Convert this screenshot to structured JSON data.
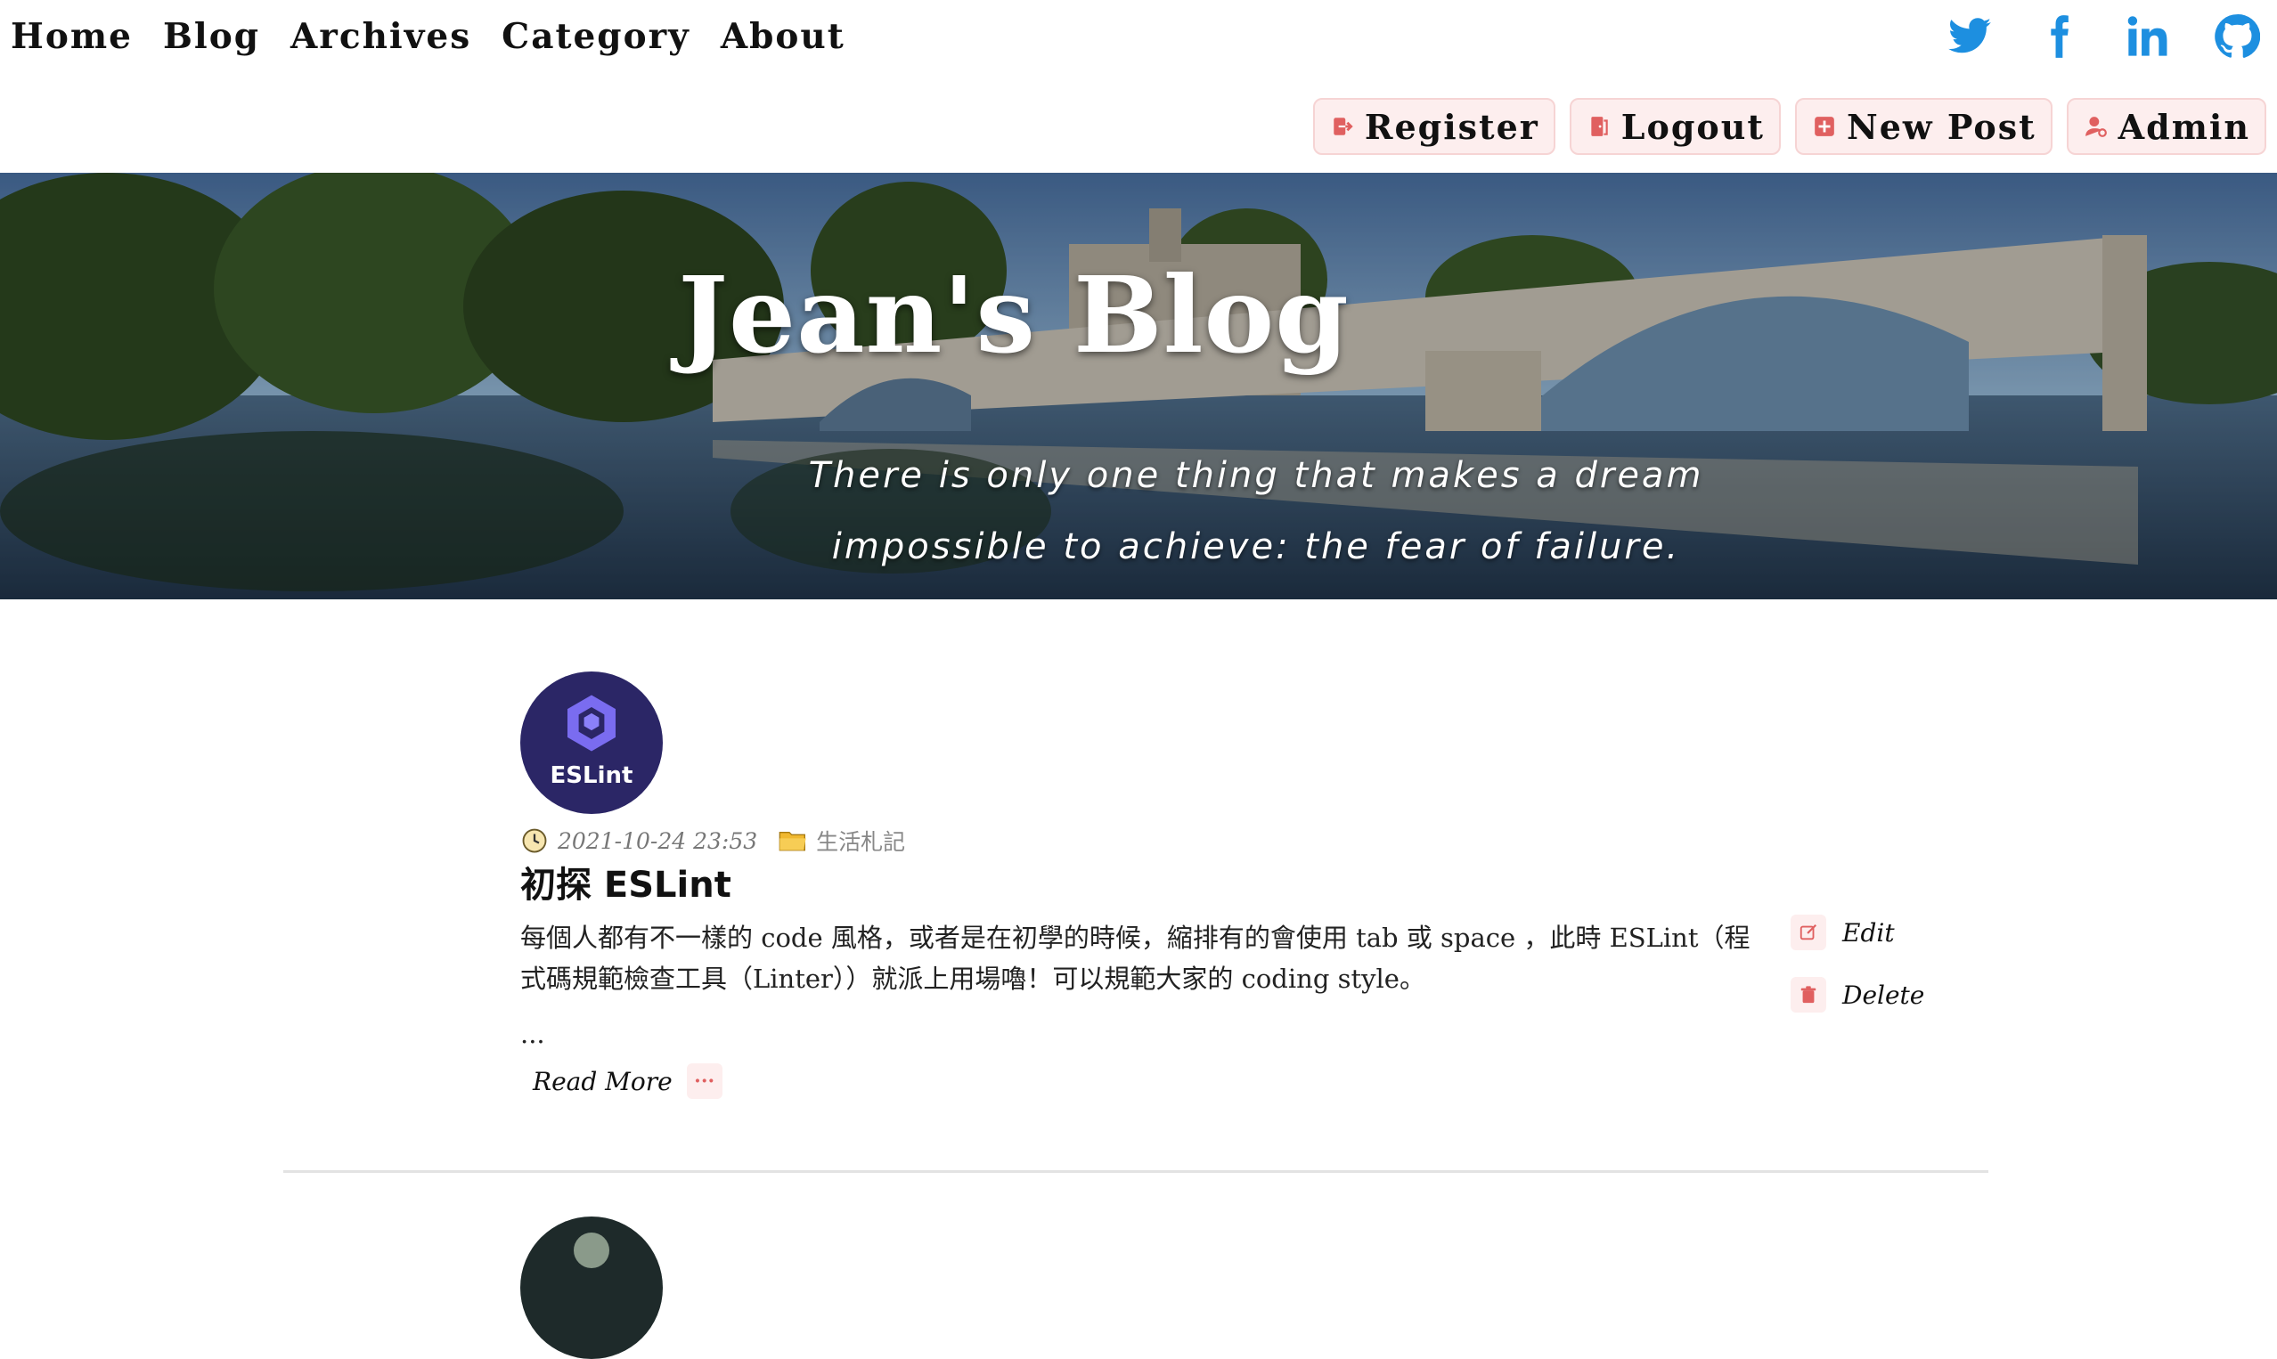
{
  "nav": {
    "items": [
      "Home",
      "Blog",
      "Archives",
      "Category",
      "About"
    ]
  },
  "social": {
    "icons": [
      "twitter-icon",
      "facebook-icon",
      "linkedin-icon",
      "github-icon"
    ],
    "brand_color": "#1d8fe0"
  },
  "actions": {
    "register": "Register",
    "logout": "Logout",
    "new_post": "New Post",
    "admin": "Admin",
    "icon_color": "#e06060",
    "bg_color": "#fdeeee"
  },
  "hero": {
    "title": "Jean's Blog",
    "quote": "There is only one thing that makes a dream impossible to achieve: the fear of failure."
  },
  "post": {
    "avatar_label": "ESLint",
    "date": "2021-10-24 23:53",
    "category": "生活札記",
    "title": "初探 ESLint",
    "excerpt": "每個人都有不一樣的 code 風格，或者是在初學的時候，縮排有的會使用 tab 或 space ，此時 ESLint（程式碼規範檢查工具（Linter））就派上用場嚕！可以規範大家的 coding style。",
    "ellipsis": "...",
    "read_more": "Read More",
    "read_more_icon": "···",
    "edit": "Edit",
    "delete": "Delete"
  }
}
